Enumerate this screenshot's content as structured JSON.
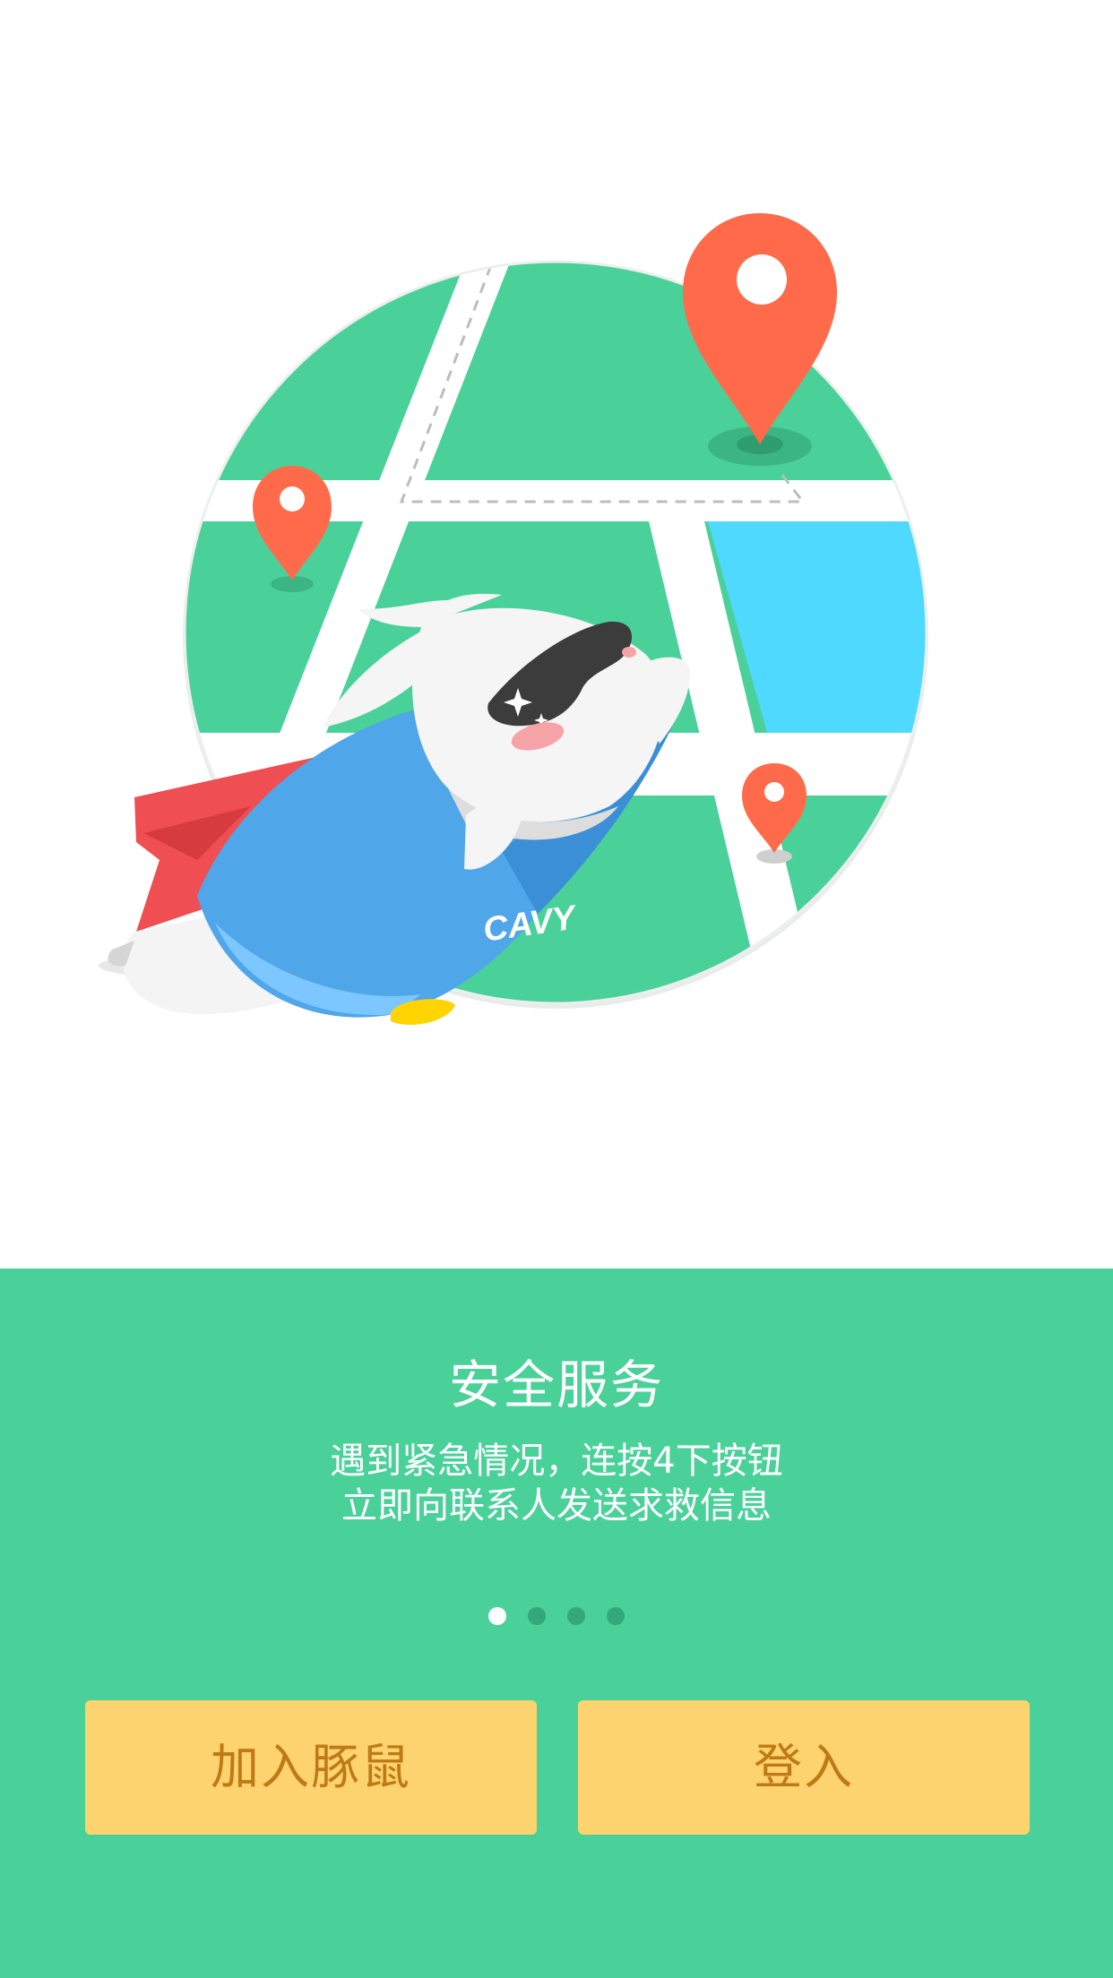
{
  "onboarding": {
    "title": "安全服务",
    "description_line1": "遇到紧急情况，连按4下按钮",
    "description_line2": "立即向联系人发送求救信息",
    "page_indicator": {
      "current": 1,
      "total": 4
    },
    "illustration_text": "CAVY"
  },
  "actions": {
    "join_label": "加入豚鼠",
    "login_label": "登入"
  },
  "colors": {
    "brand_green": "#4AD199",
    "button_yellow": "#FCD36E",
    "button_text": "#C07A15",
    "pin_orange": "#FF6B4A",
    "water_blue": "#50D9FF",
    "cape_red": "#EF4F53",
    "suit_blue": "#4FA6E8"
  }
}
